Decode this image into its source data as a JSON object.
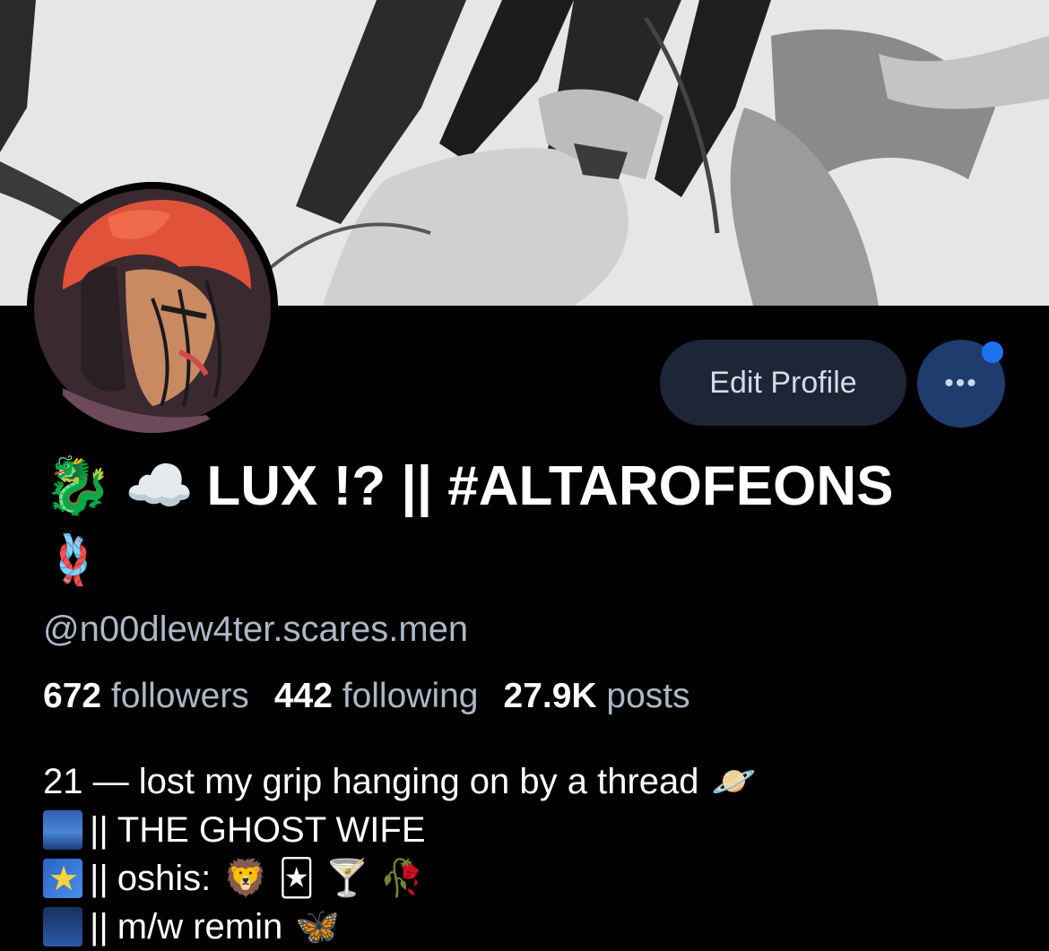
{
  "profile": {
    "display_name": "LUX !? || #ALTAROFEONS",
    "name_emoji_prefix": [
      "🐉",
      "☁️"
    ],
    "name_line2_emoji": "🪢",
    "handle": "@n00dlew4ter.scares.men",
    "edit_profile_label": "Edit Profile",
    "more_label": "•••"
  },
  "stats": [
    {
      "value": "672",
      "label": "followers"
    },
    {
      "value": "442",
      "label": "following"
    },
    {
      "value": "27.9K",
      "label": "posts"
    }
  ],
  "bio": {
    "line1": "21 — lost my grip hanging on by a thread",
    "line1_emoji": "🪐",
    "line2": "THE GHOST WIFE",
    "line3": "oshis:",
    "line3_emoji": "🦁 🃏 🍸 🥀",
    "line4": "m/w remin",
    "line4_emoji": "🦋",
    "separator": "||",
    "line2_icon": "cityscape-icon",
    "line3_icon": "star-tile-icon",
    "line4_icon": "night-city-icon"
  },
  "colors": {
    "background": "#000000",
    "secondary_text": "#aeb7c5",
    "edit_button_bg": "#1d2636",
    "more_button_bg": "#1e3d6e",
    "notification_dot": "#1d72f2"
  }
}
